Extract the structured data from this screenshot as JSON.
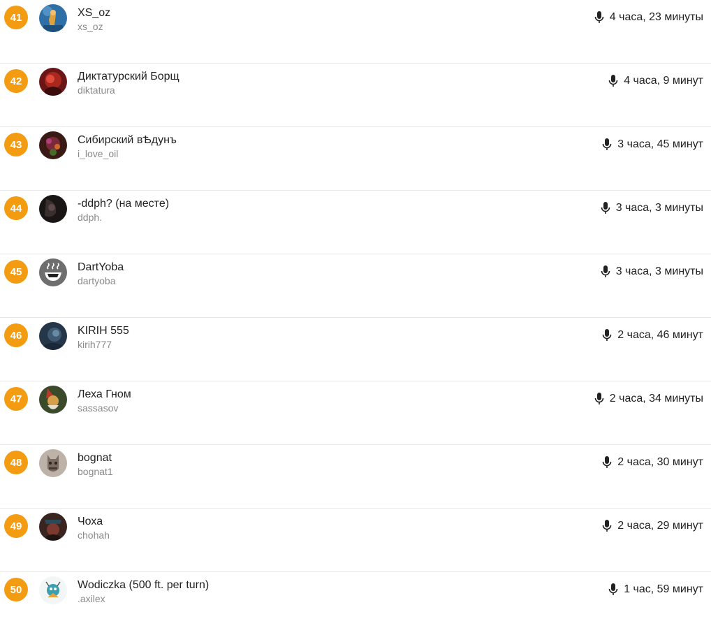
{
  "rows": [
    {
      "rank": "41",
      "display_name": "XS_oz",
      "username": "xs_oz",
      "time": "4 часа, 23 минуты",
      "avatar": {
        "icon": "avatar-xs-oz-icon",
        "bg": "#2f6fa8",
        "fg": "#e0a23a"
      }
    },
    {
      "rank": "42",
      "display_name": "Диктатурский Борщ",
      "username": "diktatura",
      "time": "4 часа, 9 минут",
      "avatar": {
        "icon": "avatar-diktatura-icon",
        "bg": "#6b1616",
        "fg": "#e04a3a"
      }
    },
    {
      "rank": "43",
      "display_name": "Сибирский вѢдунъ",
      "username": "i_love_oil",
      "time": "3 часа, 45 минут",
      "avatar": {
        "icon": "avatar-i-love-oil-icon",
        "bg": "#3a1a14",
        "fg": "#b0407a"
      }
    },
    {
      "rank": "44",
      "display_name": "-ddph? (на месте)",
      "username": "ddph.",
      "time": "3 часа, 3 минуты",
      "avatar": {
        "icon": "avatar-ddph-icon",
        "bg": "#1a1616",
        "fg": "#5a4a4a"
      }
    },
    {
      "rank": "45",
      "display_name": "DartYoba",
      "username": "dartyoba",
      "time": "3 часа, 3 минуты",
      "avatar": {
        "icon": "avatar-dartyoba-icon",
        "bg": "#6e6e6e",
        "fg": "#ffffff"
      }
    },
    {
      "rank": "46",
      "display_name": "KIRIH 555",
      "username": "kirih777",
      "time": "2 часа, 46 минут",
      "avatar": {
        "icon": "avatar-kirih-icon",
        "bg": "#243648",
        "fg": "#6a8aa4"
      }
    },
    {
      "rank": "47",
      "display_name": "Леха Гном",
      "username": "sassasov",
      "time": "2 часа, 34 минуты",
      "avatar": {
        "icon": "avatar-sassasov-icon",
        "bg": "#3b4a2a",
        "fg": "#d6a04a"
      }
    },
    {
      "rank": "48",
      "display_name": "bognat",
      "username": "bognat1",
      "time": "2 часа, 30 минут",
      "avatar": {
        "icon": "avatar-bognat-icon",
        "bg": "#bdb2a8",
        "fg": "#6a5a50"
      }
    },
    {
      "rank": "49",
      "display_name": "Чоха",
      "username": "chohah",
      "time": "2 часа, 29 минут",
      "avatar": {
        "icon": "avatar-chohah-icon",
        "bg": "#3a2420",
        "fg": "#7a3a30"
      }
    },
    {
      "rank": "50",
      "display_name": "Wodiczka (500 ft. per turn)",
      "username": ".axilex",
      "time": "1 час, 59 минут",
      "avatar": {
        "icon": "avatar-axilex-icon",
        "bg": "#f3f6f6",
        "fg": "#3aa0b0"
      }
    }
  ],
  "icons": {
    "time_icon": "microphone-icon"
  },
  "colors": {
    "rank_badge": "#f39c12",
    "primary_text": "#222222",
    "secondary_text": "#8a8a8a",
    "divider": "#e8e8e8"
  }
}
